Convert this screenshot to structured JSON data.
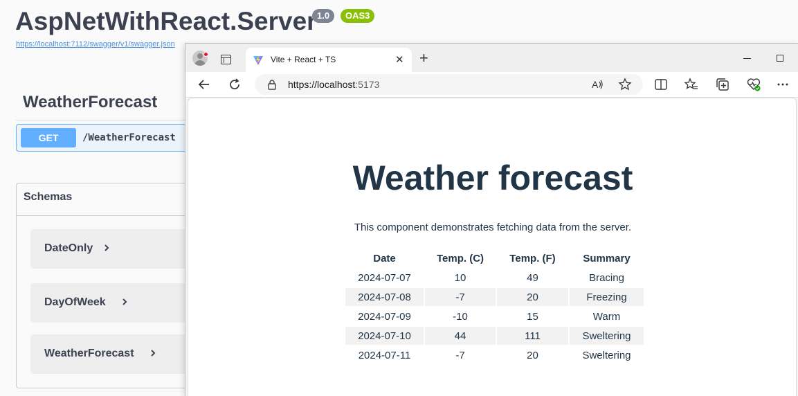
{
  "swagger": {
    "title": "AspNetWithReact.Server",
    "version_badge": "1.0",
    "oas_badge": "OAS3",
    "spec_url": "https://localhost:7112/swagger/v1/swagger.json",
    "tag": "WeatherForecast",
    "operation": {
      "method": "GET",
      "path": "/WeatherForecast"
    },
    "schemas_title": "Schemas",
    "schemas": [
      "DateOnly",
      "DayOfWeek",
      "WeatherForecast"
    ]
  },
  "browser": {
    "tab_title": "Vite + React + TS",
    "address": {
      "scheme_host": "https://localhost",
      "port": ":5173"
    },
    "icons": [
      "back-icon",
      "refresh-icon",
      "lock-icon",
      "read-aloud-icon",
      "favorite-icon",
      "split-screen-icon",
      "favorites-icon",
      "collections-icon",
      "browser-essentials-icon",
      "more-icon"
    ]
  },
  "page": {
    "heading": "Weather forecast",
    "description": "This component demonstrates fetching data from the server.",
    "table": {
      "headers": [
        "Date",
        "Temp. (C)",
        "Temp. (F)",
        "Summary"
      ],
      "rows": [
        [
          "2024-07-07",
          "10",
          "49",
          "Bracing"
        ],
        [
          "2024-07-08",
          "-7",
          "20",
          "Freezing"
        ],
        [
          "2024-07-09",
          "-10",
          "15",
          "Warm"
        ],
        [
          "2024-07-10",
          "44",
          "111",
          "Sweltering"
        ],
        [
          "2024-07-11",
          "-7",
          "20",
          "Sweltering"
        ]
      ]
    }
  },
  "colors": {
    "get_blue": "#61affe",
    "oas_green": "#89bf04",
    "heading": "#213547"
  }
}
